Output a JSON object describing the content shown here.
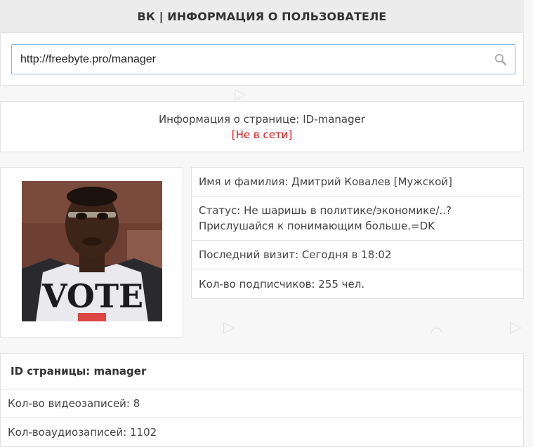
{
  "header": {
    "title": "ВК | ИНФОРМАЦИЯ О ПОЛЬЗОВАТЕЛЕ"
  },
  "search": {
    "value": "http://freebyte.pro/manager",
    "icon": "search-icon"
  },
  "page_info": {
    "title": "Информация о странице: ID-manager",
    "status": "[Не в сети]"
  },
  "photo": {
    "shirt_text": "VOTE"
  },
  "details": {
    "name": "Имя и фамилия: Дмитрий Ковалев [Мужской]",
    "status": "Статус: Не шаришь в политике/экономике/..? Прислушайся к понимающим больше.=DK",
    "last_visit": "Последний визит: Сегодня в 18:02",
    "followers": "Кол-во подписчиков: 255 чел."
  },
  "page_id": {
    "title": "ID страницы: manager",
    "videos": "Кол-во видеозаписей: 8",
    "audios": "Кол-воаудиозаписей: 1102"
  },
  "colors": {
    "accent_border": "#8ab4e8",
    "offline": "#dd1111",
    "header_bg": "#ececec"
  }
}
